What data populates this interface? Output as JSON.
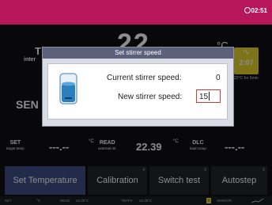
{
  "header": {
    "clock": "02:51"
  },
  "main": {
    "temp_big": "22",
    "temp_unit": "°C",
    "title_letter": "T",
    "title_sub": "inter",
    "sensor_label": "SEN",
    "timer": {
      "value": "2:07",
      "note": "22°C for 5min",
      "color": "#e3d12e"
    }
  },
  "readings": {
    "set_label": "SET",
    "set_sub": "target temp",
    "set_value": "---.--",
    "set_unit": "°C",
    "read_label": "READ",
    "read_sub": "external rel.",
    "read_value": "22.39",
    "read_unit": "°C",
    "dlc_label": "DLC",
    "dlc_sub": "load comp",
    "dlc_value": "---.--"
  },
  "tabs": [
    {
      "label": "Set Temperature",
      "corner": ""
    },
    {
      "label": "Calibration",
      "corner": "4"
    },
    {
      "label": "Switch test",
      "corner": "5"
    },
    {
      "label": "Autostep",
      "corner": "6"
    }
  ],
  "statusbar": {
    "set": "SET",
    "set_val": "°C",
    "read": "READ",
    "read_val": "22.39°C",
    "tbath": "TBATH",
    "tbath_val": "22.38°C",
    "timer": "T",
    "sensor": "SENSOR"
  },
  "dialog": {
    "title": "Set stirrer speed",
    "current_label": "Current stirrer speed:",
    "current_value": "0",
    "new_label": "New stirrer speed:",
    "new_value": "15"
  },
  "colors": {
    "accent": "#b8165a",
    "active_tab": "#3f4f86",
    "dialog_title": "#5c607a",
    "input_border": "#d33a3a"
  }
}
